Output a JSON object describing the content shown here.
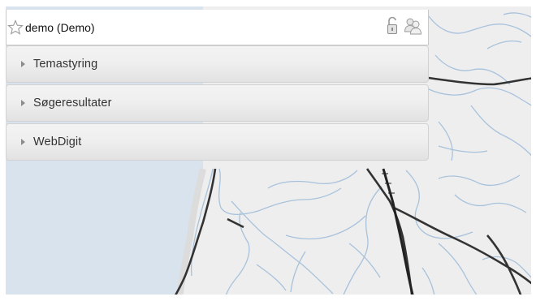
{
  "header": {
    "user_label": "demo (Demo)",
    "icons": [
      "star-icon",
      "lock-icon",
      "users-icon"
    ]
  },
  "sections": [
    {
      "label": "Temastyring",
      "icon": "expand-arrow-icon"
    },
    {
      "label": "Søgeresultater",
      "icon": "expand-arrow-icon"
    },
    {
      "label": "WebDigit",
      "icon": "expand-arrow-icon"
    }
  ],
  "map": {
    "colors": {
      "land": "#eeeeee",
      "sea": "#d8e3ee",
      "stream": "#9fbcd9",
      "road": "#333333",
      "railway": "#2a2a2a"
    }
  }
}
